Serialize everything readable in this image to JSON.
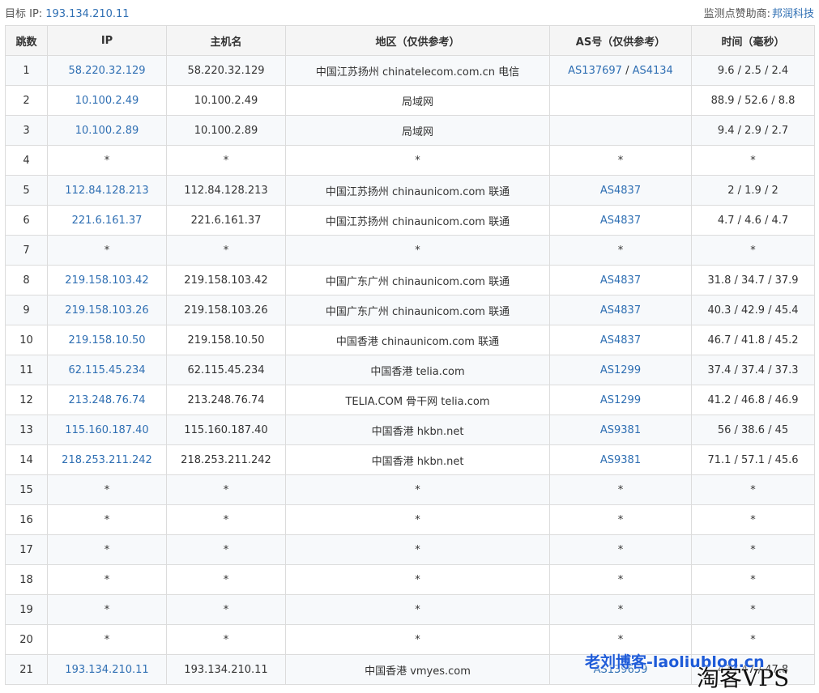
{
  "header": {
    "target_label": "目标 IP:",
    "target_ip": "193.134.210.11",
    "sponsor_label": "监测点赞助商:",
    "sponsor_name": "邦润科技"
  },
  "columns": [
    "跳数",
    "IP",
    "主机名",
    "地区（仅供参考）",
    "AS号（仅供参考）",
    "时间（毫秒）"
  ],
  "rows": [
    {
      "hop": "1",
      "ip": "58.220.32.129",
      "host": "58.220.32.129",
      "region": "中国江苏扬州 chinatelecom.com.cn 电信",
      "as": [
        "AS137697",
        "AS4134"
      ],
      "time": "9.6 / 2.5 / 2.4"
    },
    {
      "hop": "2",
      "ip": "10.100.2.49",
      "host": "10.100.2.49",
      "region": "局域网",
      "as": [],
      "time": "88.9 / 52.6 / 8.8"
    },
    {
      "hop": "3",
      "ip": "10.100.2.89",
      "host": "10.100.2.89",
      "region": "局域网",
      "as": [],
      "time": "9.4 / 2.9 / 2.7"
    },
    {
      "hop": "4",
      "ip": "*",
      "host": "*",
      "region": "*",
      "as": [
        "*"
      ],
      "time": "*"
    },
    {
      "hop": "5",
      "ip": "112.84.128.213",
      "host": "112.84.128.213",
      "region": "中国江苏扬州 chinaunicom.com 联通",
      "as": [
        "AS4837"
      ],
      "time": "2 / 1.9 / 2"
    },
    {
      "hop": "6",
      "ip": "221.6.161.37",
      "host": "221.6.161.37",
      "region": "中国江苏扬州 chinaunicom.com 联通",
      "as": [
        "AS4837"
      ],
      "time": "4.7 / 4.6 / 4.7"
    },
    {
      "hop": "7",
      "ip": "*",
      "host": "*",
      "region": "*",
      "as": [
        "*"
      ],
      "time": "*"
    },
    {
      "hop": "8",
      "ip": "219.158.103.42",
      "host": "219.158.103.42",
      "region": "中国广东广州 chinaunicom.com 联通",
      "as": [
        "AS4837"
      ],
      "time": "31.8 / 34.7 / 37.9"
    },
    {
      "hop": "9",
      "ip": "219.158.103.26",
      "host": "219.158.103.26",
      "region": "中国广东广州 chinaunicom.com 联通",
      "as": [
        "AS4837"
      ],
      "time": "40.3 / 42.9 / 45.4"
    },
    {
      "hop": "10",
      "ip": "219.158.10.50",
      "host": "219.158.10.50",
      "region": "中国香港 chinaunicom.com 联通",
      "as": [
        "AS4837"
      ],
      "time": "46.7 / 41.8 / 45.2"
    },
    {
      "hop": "11",
      "ip": "62.115.45.234",
      "host": "62.115.45.234",
      "region": "中国香港 telia.com",
      "as": [
        "AS1299"
      ],
      "time": "37.4 / 37.4 / 37.3"
    },
    {
      "hop": "12",
      "ip": "213.248.76.74",
      "host": "213.248.76.74",
      "region": "TELIA.COM 骨干网 telia.com",
      "as": [
        "AS1299"
      ],
      "time": "41.2 / 46.8 / 46.9"
    },
    {
      "hop": "13",
      "ip": "115.160.187.40",
      "host": "115.160.187.40",
      "region": "中国香港 hkbn.net",
      "as": [
        "AS9381"
      ],
      "time": "56 / 38.6 / 45"
    },
    {
      "hop": "14",
      "ip": "218.253.211.242",
      "host": "218.253.211.242",
      "region": "中国香港 hkbn.net",
      "as": [
        "AS9381"
      ],
      "time": "71.1 / 57.1 / 45.6"
    },
    {
      "hop": "15",
      "ip": "*",
      "host": "*",
      "region": "*",
      "as": [
        "*"
      ],
      "time": "*"
    },
    {
      "hop": "16",
      "ip": "*",
      "host": "*",
      "region": "*",
      "as": [
        "*"
      ],
      "time": "*"
    },
    {
      "hop": "17",
      "ip": "*",
      "host": "*",
      "region": "*",
      "as": [
        "*"
      ],
      "time": "*"
    },
    {
      "hop": "18",
      "ip": "*",
      "host": "*",
      "region": "*",
      "as": [
        "*"
      ],
      "time": "*"
    },
    {
      "hop": "19",
      "ip": "*",
      "host": "*",
      "region": "*",
      "as": [
        "*"
      ],
      "time": "*"
    },
    {
      "hop": "20",
      "ip": "*",
      "host": "*",
      "region": "*",
      "as": [
        "*"
      ],
      "time": "*"
    },
    {
      "hop": "21",
      "ip": "193.134.210.11",
      "host": "193.134.210.11",
      "region": "中国香港 vmyes.com",
      "as": [
        "AS139659"
      ],
      "time": "47 / 47 / 47.8"
    }
  ],
  "watermarks": {
    "blog": "老刘博客-laoliublog.cn",
    "vps": "淘客VPS"
  },
  "colors": {
    "link": "#2f6fb3",
    "border": "#dcdcdc",
    "header_bg": "#f5f5f5",
    "stripe_bg": "#f7f9fb"
  }
}
